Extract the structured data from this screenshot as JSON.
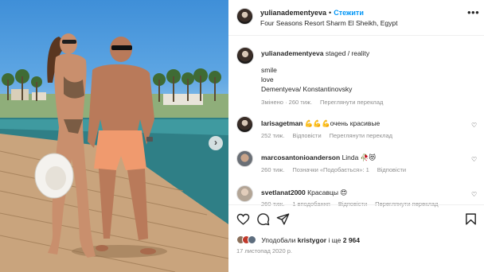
{
  "post": {
    "next_icon": "chevron-right-icon"
  },
  "header": {
    "username": "yulianadementyeva",
    "separator": "•",
    "follow_label": "Стежити",
    "location": "Four Seasons Resort Sharm El Sheikh, Egypt",
    "more_icon": "more-horizontal-icon"
  },
  "caption": {
    "username": "yulianadementyeva",
    "first_line": "staged / reality",
    "lines": [
      "smile",
      "love",
      "Dementyeva/ Konstantinovsky"
    ],
    "edited_label": "Змінено",
    "age": "260 тиж.",
    "translate_label": "Переглянути переклад"
  },
  "comments": [
    {
      "username": "larisagetman",
      "text": "💪💪💪очень красивые",
      "age": "252 тиж.",
      "reply_label": "Відповісти",
      "translate_label": "Переглянути переклад"
    },
    {
      "username": "marcosantonioanderson",
      "text": "Linda 🥀😻",
      "age": "260 тиж.",
      "likes_label": "Позначки «Подобається»: 1",
      "reply_label": "Відповісти"
    },
    {
      "username": "svetlanat2000",
      "text": "Красавцы 😍",
      "age": "260 тиж.",
      "likes_label": "1 вподобання",
      "reply_label": "Відповісти",
      "translate_label": "Переглянути переклад"
    }
  ],
  "actions": {
    "like_icon": "heart-icon",
    "comment_icon": "comment-icon",
    "share_icon": "send-icon",
    "save_icon": "bookmark-icon"
  },
  "likes": {
    "prefix": "Уподобали",
    "user": "kristygor",
    "middle": "і ще",
    "count": "2 964"
  },
  "date": "17 листопад 2020 р.",
  "colors": {
    "link_blue": "#0095f6",
    "meta_gray": "#8e8e8e",
    "text": "#262626"
  }
}
